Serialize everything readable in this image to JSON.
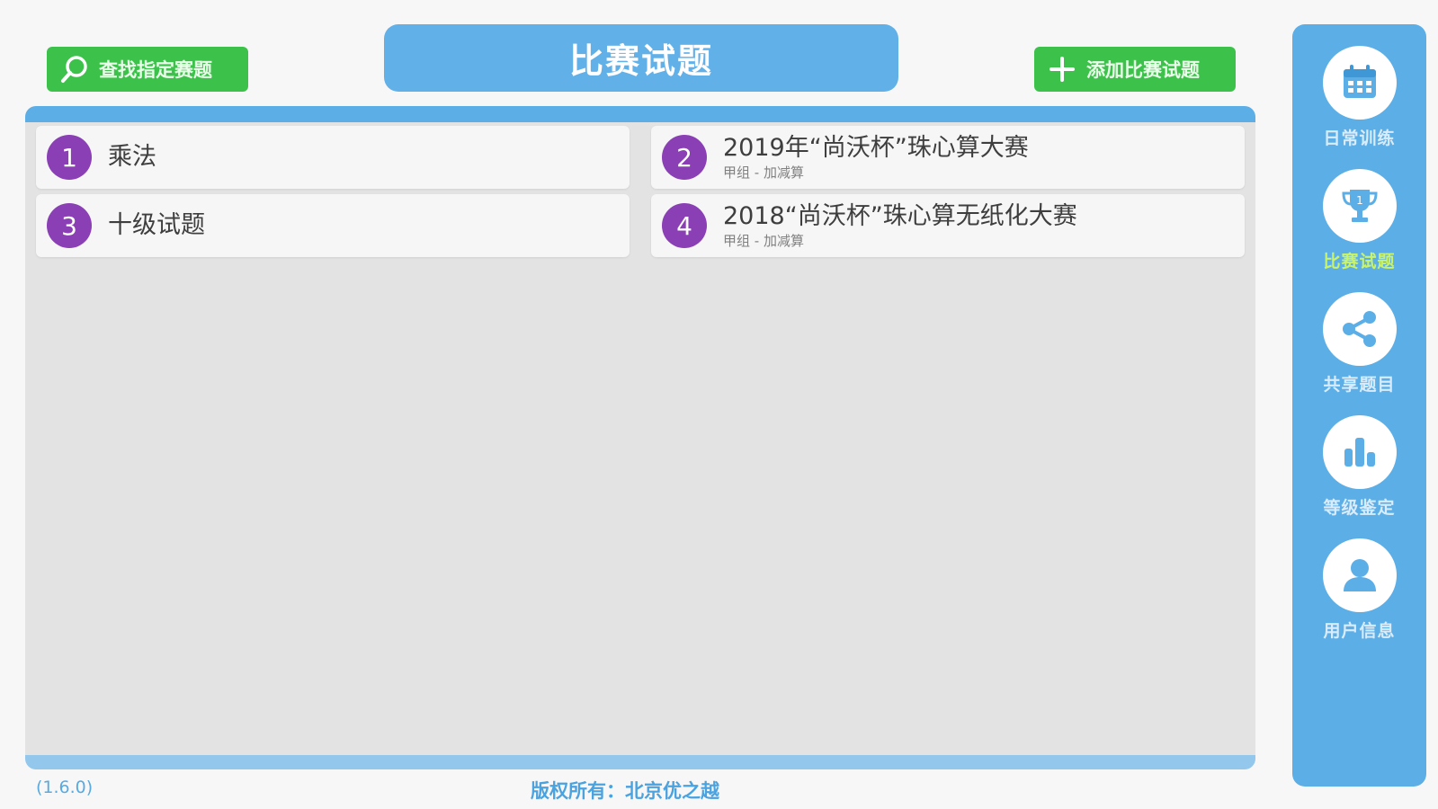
{
  "header": {
    "title": "比赛试题",
    "search_button": {
      "label": "查找指定赛题",
      "icon": "search-icon"
    },
    "add_button": {
      "label": "添加比赛试题",
      "icon": "plus-icon"
    }
  },
  "list": {
    "items": [
      {
        "number": "1",
        "title": "乘法",
        "subtitle": ""
      },
      {
        "number": "2",
        "title": "2019年“尚沃杯”珠心算大赛",
        "subtitle": "甲组 - 加减算"
      },
      {
        "number": "3",
        "title": "十级试题",
        "subtitle": ""
      },
      {
        "number": "4",
        "title": "2018“尚沃杯”珠心算无纸化大赛",
        "subtitle": "甲组 - 加减算"
      }
    ]
  },
  "sidebar": {
    "items": [
      {
        "label": "日常训练",
        "icon": "calendar-icon",
        "active": false
      },
      {
        "label": "比赛试题",
        "icon": "trophy-icon",
        "active": true
      },
      {
        "label": "共享题目",
        "icon": "share-icon",
        "active": false
      },
      {
        "label": "等级鉴定",
        "icon": "bar-chart-icon",
        "active": false
      },
      {
        "label": "用户信息",
        "icon": "user-icon",
        "active": false
      }
    ]
  },
  "footer": {
    "version": "(1.6.0)",
    "copyright": "版权所有：北京优之越"
  },
  "colors": {
    "accent_blue": "#5caee6",
    "button_green": "#3cc24a",
    "number_purple": "#8a3fb5",
    "active_label": "#c9f36b"
  }
}
